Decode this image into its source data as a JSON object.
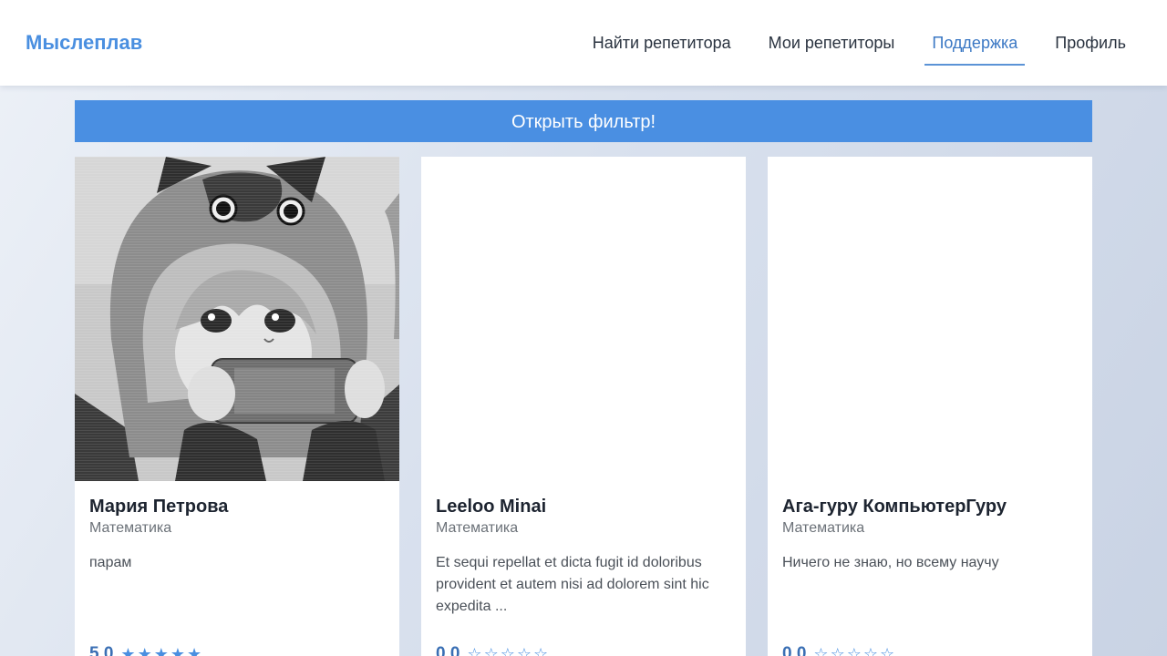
{
  "header": {
    "logo": "Мыслеплав",
    "nav": [
      {
        "label": "Найти репетитора",
        "active": false
      },
      {
        "label": "Мои репетиторы",
        "active": false
      },
      {
        "label": "Поддержка",
        "active": true
      },
      {
        "label": "Профиль",
        "active": false
      }
    ]
  },
  "filter_button": {
    "label": "Открыть фильтр!"
  },
  "cards": [
    {
      "name": "Мария Петрова",
      "subject": "Математика",
      "description": "парам",
      "rating": "5.0",
      "stars_filled": 5,
      "has_image": true,
      "image_icon": "anime-avatar-image"
    },
    {
      "name": "Leeloo Minai",
      "subject": "Математика",
      "description": "Et sequi repellat et dicta fugit id doloribus provident et autem nisi ad dolorem sint hic expedita ...",
      "rating": "0.0",
      "stars_filled": 0,
      "has_image": false
    },
    {
      "name": "Ага-гуру КомпьютерГуру",
      "subject": "Математика",
      "description": "Ничего не знаю, но всему научу",
      "rating": "0.0",
      "stars_filled": 0,
      "has_image": false
    }
  ],
  "colors": {
    "accent": "#4a8fe2",
    "logo": "#4a8fe0",
    "nav_active": "#3b78c4",
    "star": "#4a8fe0"
  }
}
